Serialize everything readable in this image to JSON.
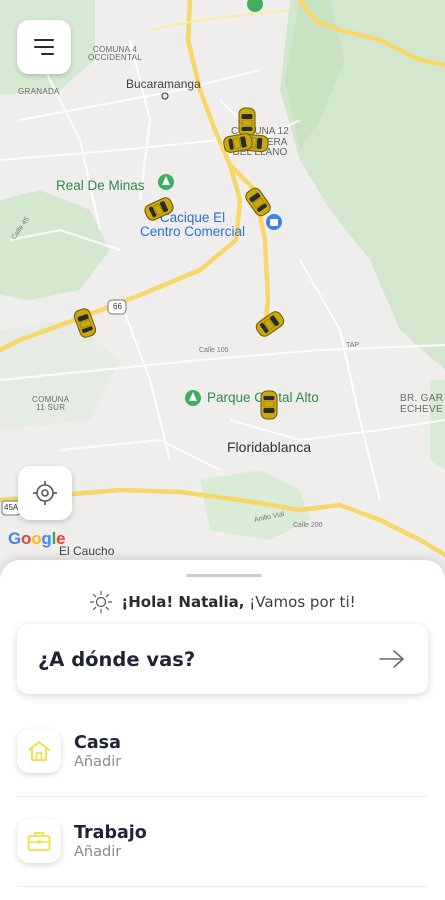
{
  "map": {
    "labels": {
      "comuna4": "COMUNA 4\nOCCIDENTAL",
      "granada": "GRANADA",
      "bucaramanga": "Bucaramanga",
      "comuna12": "COMUNA 12\nCABECERA\nDEL LLANO",
      "real_de_minas": "Real De Minas",
      "cacique": "Cacique El\nCentro Comercial",
      "calle45": "Calle 45",
      "route66": "66",
      "calle105": "Calle 105",
      "tap": "TAP",
      "comuna11": "COMUNA\n11 SUR",
      "parque_cristal": "Parque Cristal Alto",
      "br_garcia": "BR. GAR\nECHEVE",
      "floridablanca": "Floridablanca",
      "route45a": "45A",
      "anillo_vial": "Anillo Vial",
      "calle200": "Calle 200",
      "el_caucho": "El Caucho"
    },
    "google": "Google"
  },
  "icons": {
    "menu": "menu-icon",
    "locate": "locate-icon",
    "sun": "sun-icon",
    "arrow": "arrow-right-icon",
    "home": "home-icon",
    "briefcase": "briefcase-icon",
    "taxi": "taxi-icon"
  },
  "colors": {
    "accent_yellow": "#f2dd44",
    "taxi_yellow": "#c9a90f",
    "text_dark": "#1f2435",
    "text_muted": "#8a8a8a"
  },
  "sheet": {
    "greeting_bold": "¡Hola! Natalia,",
    "greeting_rest": " ¡Vamos por ti!",
    "search_label": "¿A dónde vas?",
    "places": [
      {
        "title": "Casa",
        "subtitle": "Añadir"
      },
      {
        "title": "Trabajo",
        "subtitle": "Añadir"
      }
    ]
  }
}
